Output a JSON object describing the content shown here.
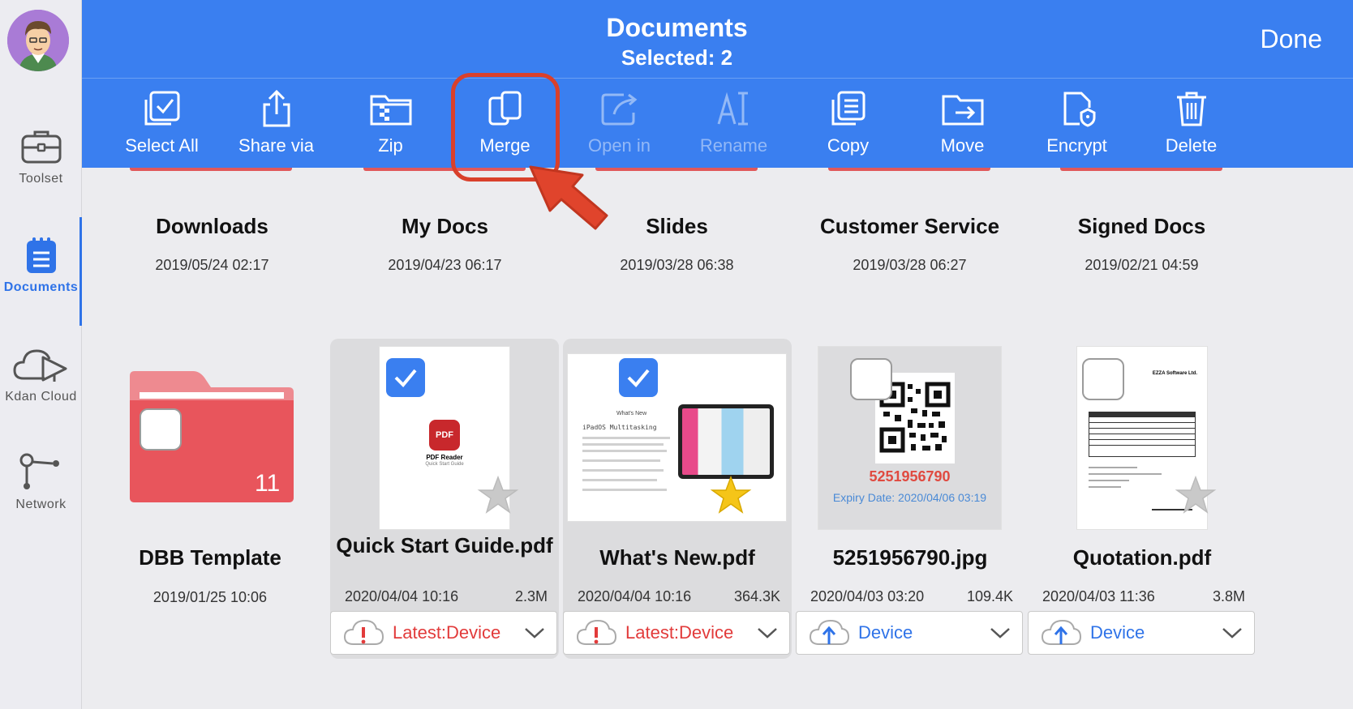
{
  "colors": {
    "primary": "#3a7ff0",
    "accent_red": "#e23b3b",
    "folder_red": "#e8555c",
    "star_gold": "#f5c518"
  },
  "sidebar": {
    "avatar": "user-avatar",
    "items": [
      {
        "label": "Toolset",
        "icon": "toolbox-icon"
      },
      {
        "label": "Documents",
        "icon": "documents-icon",
        "active": true
      },
      {
        "label": "Kdan Cloud",
        "icon": "cloud-icon"
      },
      {
        "label": "Network",
        "icon": "network-icon"
      }
    ]
  },
  "header": {
    "title": "Documents",
    "subtitle": "Selected: 2",
    "done_label": "Done"
  },
  "toolbar": {
    "items": [
      {
        "label": "Select All",
        "icon": "select-all-icon"
      },
      {
        "label": "Share via",
        "icon": "share-icon"
      },
      {
        "label": "Zip",
        "icon": "zip-icon"
      },
      {
        "label": "Merge",
        "icon": "merge-icon"
      },
      {
        "label": "Open in",
        "icon": "open-in-icon",
        "disabled": true
      },
      {
        "label": "Rename",
        "icon": "rename-icon",
        "disabled": true
      },
      {
        "label": "Copy",
        "icon": "copy-icon"
      },
      {
        "label": "Move",
        "icon": "move-icon"
      },
      {
        "label": "Encrypt",
        "icon": "encrypt-icon"
      },
      {
        "label": "Delete",
        "icon": "delete-icon"
      }
    ]
  },
  "folders": [
    {
      "name": "Downloads",
      "date": "2019/05/24 02:17"
    },
    {
      "name": "My Docs",
      "date": "2019/04/23 06:17"
    },
    {
      "name": "Slides",
      "date": "2019/03/28 06:38"
    },
    {
      "name": "Customer Service",
      "date": "2019/03/28 06:27"
    },
    {
      "name": "Signed Docs",
      "date": "2019/02/21 04:59"
    }
  ],
  "files": [
    {
      "name": "DBB Template",
      "date": "2019/01/25 10:06",
      "type": "folder",
      "count": "11",
      "selected": false
    },
    {
      "name": "Quick Start Guide.pdf",
      "date": "2020/04/04 10:16",
      "size": "2.3M",
      "selected": true,
      "starred": false,
      "cloud_status": "Latest:Device",
      "thumb_title": "PDF Reader",
      "thumb_sub": "Quick Start Guide",
      "thumb_logo": "PDF"
    },
    {
      "name": "What's New.pdf",
      "date": "2020/04/04 10:16",
      "size": "364.3K",
      "selected": true,
      "starred": true,
      "cloud_status": "Latest:Device",
      "thumb_title": "What's New",
      "thumb_sub": "iPadOS Multitasking"
    },
    {
      "name": "5251956790.jpg",
      "date": "2020/04/03 03:20",
      "size": "109.4K",
      "selected": false,
      "starred": false,
      "cloud_status": "Device",
      "thumb_code": "5251956790",
      "thumb_expiry": "Expiry Date: 2020/04/06 03:19"
    },
    {
      "name": "Quotation.pdf",
      "date": "2020/04/03 11:36",
      "size": "3.8M",
      "selected": false,
      "starred": false,
      "cloud_status": "Device",
      "thumb_company": "EZZA Software Ltd."
    }
  ]
}
